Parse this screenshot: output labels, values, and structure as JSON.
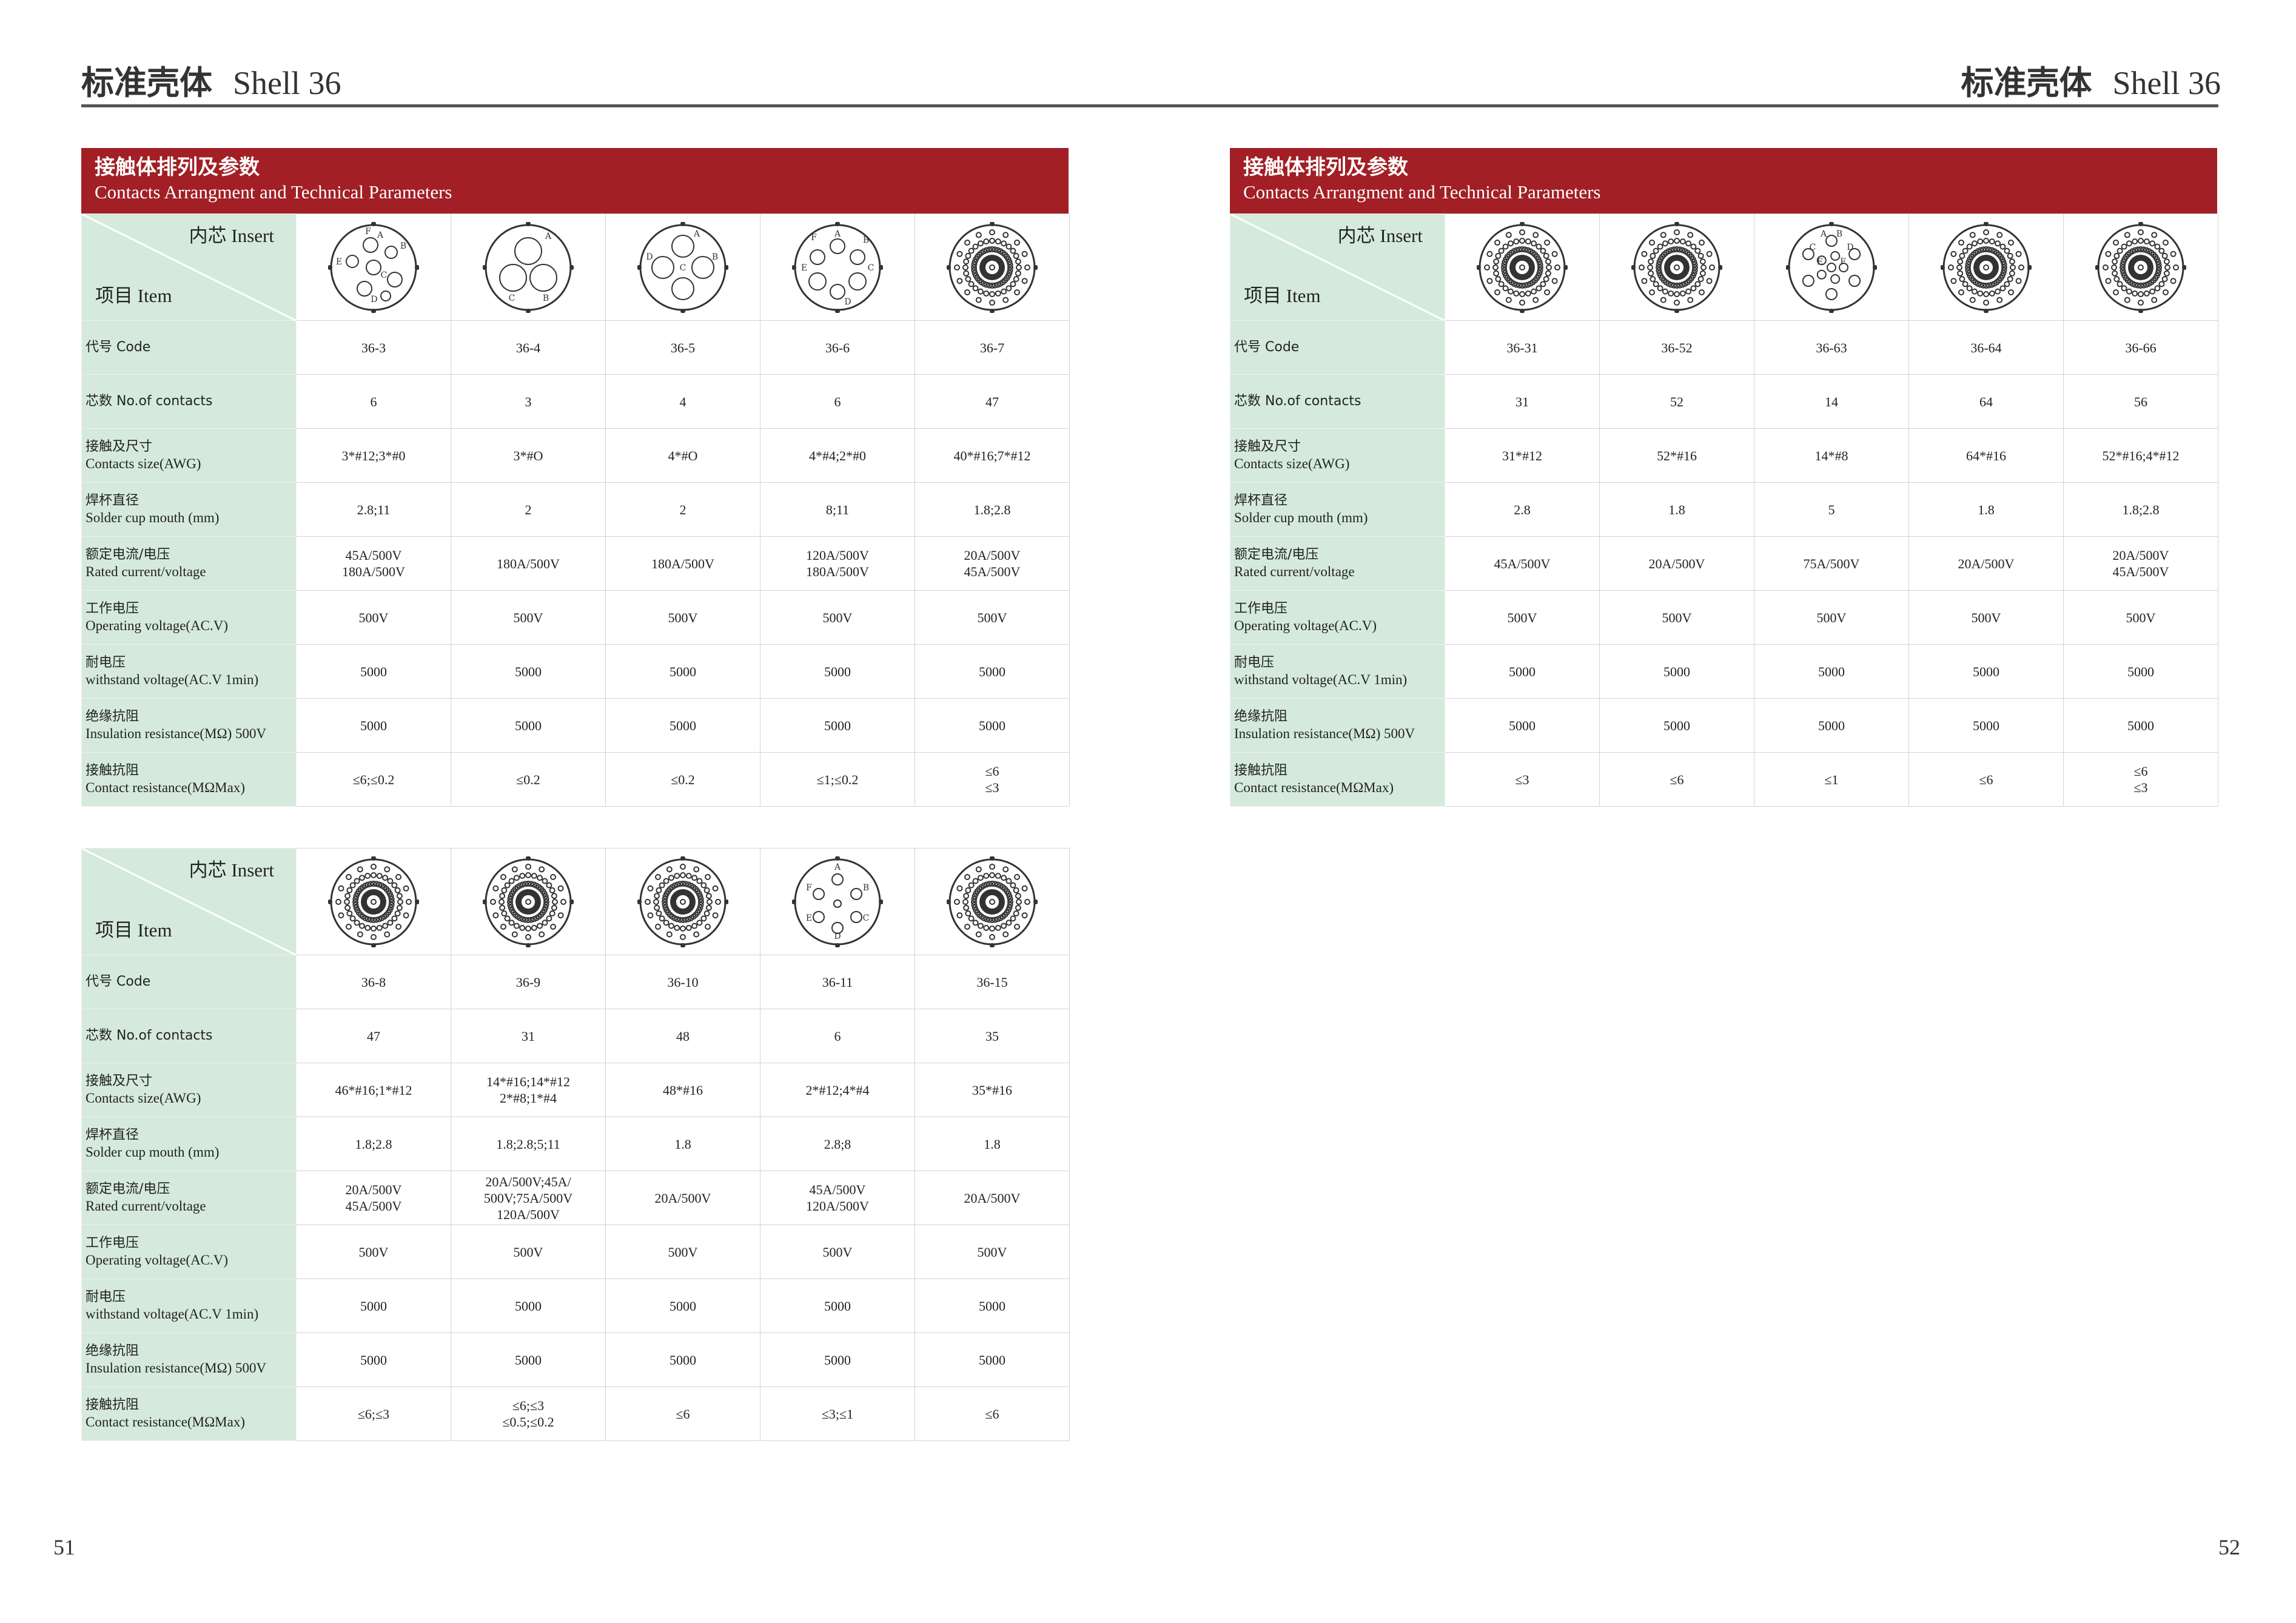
{
  "page_header": {
    "left": {
      "cn": "标准壳体",
      "en": "Shell 36"
    },
    "right": {
      "cn": "标准壳体",
      "en": "Shell 36"
    }
  },
  "page_numbers": {
    "left": "51",
    "right": "52"
  },
  "section_band": {
    "cn": "接触体排列及参数",
    "en": "Contacts Arrangment and Technical Parameters"
  },
  "corner": {
    "insert_cn": "内芯",
    "insert_en": "Insert",
    "item_cn": "项目",
    "item_en": "Item"
  },
  "row_labels": [
    {
      "cn": "代号 Code",
      "en": ""
    },
    {
      "cn": "芯数 No.of contacts",
      "en": ""
    },
    {
      "cn": "接触及尺寸",
      "en": "Contacts size(AWG)"
    },
    {
      "cn": "焊杯直径",
      "en": "Solder cup mouth (mm)"
    },
    {
      "cn": "额定电流/电压",
      "en": "Rated current/voltage"
    },
    {
      "cn": "工作电压",
      "en": "Operating voltage(AC.V)"
    },
    {
      "cn": "耐电压",
      "en": "withstand voltage(AC.V 1min)"
    },
    {
      "cn": "绝缘抗阻",
      "en": "Insulation resistance(MΩ) 500V"
    },
    {
      "cn": "接触抗阻",
      "en": "Contact resistance(MΩMax)"
    }
  ],
  "tables": [
    {
      "id": "table-1",
      "columns": [
        {
          "diagram": "layout-large-lettered",
          "letters": [
            "F",
            "A",
            "B",
            "E",
            "C",
            "D"
          ],
          "values": [
            "36-3",
            "6",
            "3*#12;3*#0",
            "2.8;11",
            "45A/500V\n180A/500V",
            "500V",
            "5000",
            "5000",
            "≤6;≤0.2"
          ]
        },
        {
          "diagram": "layout-three-large",
          "letters": [
            "A",
            "C",
            "B"
          ],
          "values": [
            "36-4",
            "3",
            "3*#O",
            "2",
            "180A/500V",
            "500V",
            "5000",
            "5000",
            "≤0.2"
          ]
        },
        {
          "diagram": "layout-four-large",
          "letters": [
            "A",
            "D",
            "B",
            "C"
          ],
          "values": [
            "36-5",
            "4",
            "4*#O",
            "2",
            "180A/500V",
            "500V",
            "5000",
            "5000",
            "≤0.2"
          ]
        },
        {
          "diagram": "layout-six-mixed",
          "letters": [
            "F",
            "A",
            "B",
            "E",
            "C",
            "D"
          ],
          "values": [
            "36-6",
            "6",
            "4*#4;2*#0",
            "8;11",
            "120A/500V\n180A/500V",
            "500V",
            "5000",
            "5000",
            "≤1;≤0.2"
          ]
        },
        {
          "diagram": "layout-dense",
          "letters": [],
          "values": [
            "36-7",
            "47",
            "40*#16;7*#12",
            "1.8;2.8",
            "20A/500V\n45A/500V",
            "500V",
            "5000",
            "5000",
            "≤6\n≤3"
          ]
        }
      ]
    },
    {
      "id": "table-2",
      "columns": [
        {
          "diagram": "layout-dense",
          "letters": [],
          "values": [
            "36-31",
            "31",
            "31*#12",
            "2.8",
            "45A/500V",
            "500V",
            "5000",
            "5000",
            "≤3"
          ]
        },
        {
          "diagram": "layout-dense",
          "letters": [],
          "values": [
            "36-52",
            "52",
            "52*#16",
            "1.8",
            "20A/500V",
            "500V",
            "5000",
            "5000",
            "≤6"
          ]
        },
        {
          "diagram": "layout-medium-lettered",
          "letters": [
            "A",
            "B",
            "C",
            "D",
            "E",
            "F"
          ],
          "values": [
            "36-63",
            "14",
            "14*#8",
            "5",
            "75A/500V",
            "500V",
            "5000",
            "5000",
            "≤1"
          ]
        },
        {
          "diagram": "layout-dense",
          "letters": [],
          "values": [
            "36-64",
            "64",
            "64*#16",
            "1.8",
            "20A/500V",
            "500V",
            "5000",
            "5000",
            "≤6"
          ]
        },
        {
          "diagram": "layout-dense",
          "letters": [],
          "values": [
            "36-66",
            "56",
            "52*#16;4*#12",
            "1.8;2.8",
            "20A/500V\n45A/500V",
            "500V",
            "5000",
            "5000",
            "≤6\n≤3"
          ]
        }
      ]
    },
    {
      "id": "table-3",
      "columns": [
        {
          "diagram": "layout-dense",
          "letters": [],
          "values": [
            "36-8",
            "47",
            "46*#16;1*#12",
            "1.8;2.8",
            "20A/500V\n45A/500V",
            "500V",
            "5000",
            "5000",
            "≤6;≤3"
          ]
        },
        {
          "diagram": "layout-dense",
          "letters": [],
          "values": [
            "36-9",
            "31",
            "14*#16;14*#12\n2*#8;1*#4",
            "1.8;2.8;5;11",
            "20A/500V;45A/\n500V;75A/500V\n120A/500V",
            "500V",
            "5000",
            "5000",
            "≤6;≤3\n≤0.5;≤0.2"
          ]
        },
        {
          "diagram": "layout-dense",
          "letters": [],
          "values": [
            "36-10",
            "48",
            "48*#16",
            "1.8",
            "20A/500V",
            "500V",
            "5000",
            "5000",
            "≤6"
          ]
        },
        {
          "diagram": "layout-six-small",
          "letters": [
            "A",
            "F",
            "B",
            "E",
            "C",
            "D"
          ],
          "values": [
            "36-11",
            "6",
            "2*#12;4*#4",
            "2.8;8",
            "45A/500V\n120A/500V",
            "500V",
            "5000",
            "5000",
            "≤3;≤1"
          ]
        },
        {
          "diagram": "layout-dense",
          "letters": [],
          "values": [
            "36-15",
            "35",
            "35*#16",
            "1.8",
            "20A/500V",
            "500V",
            "5000",
            "5000",
            "≤6"
          ]
        }
      ]
    }
  ]
}
